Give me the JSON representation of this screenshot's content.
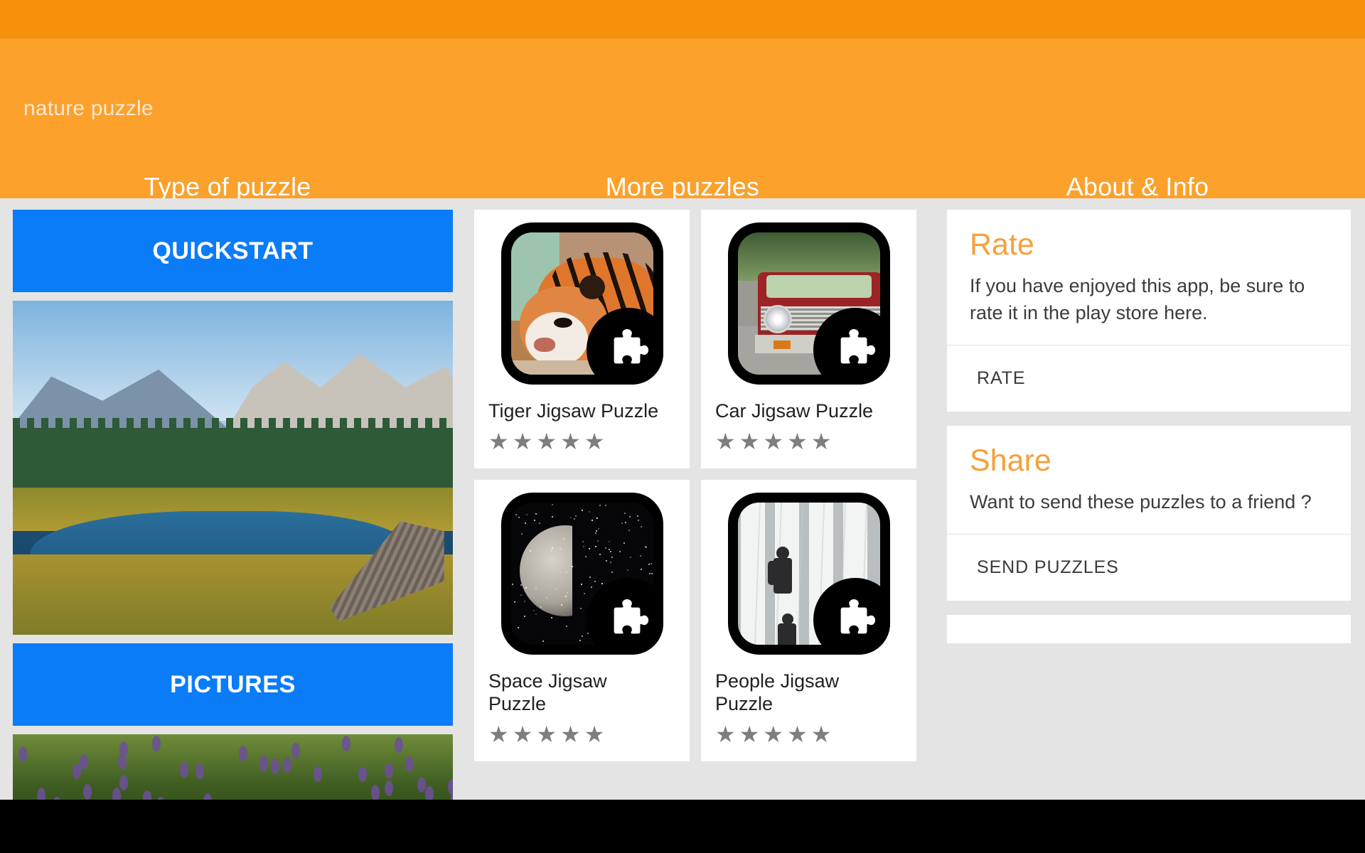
{
  "app": {
    "title": "nature puzzle",
    "accent_orange": "#FBA12C",
    "status_orange": "#F7900A",
    "accent_blue": "#0A7CF7",
    "page_background": "#E4E4E4"
  },
  "tabs": [
    {
      "label": "Type of puzzle"
    },
    {
      "label": "More puzzles"
    },
    {
      "label": "About & Info"
    }
  ],
  "left_panel": {
    "quickstart_label": "QUICKSTART",
    "pictures_label": "PICTURES",
    "preview_alt": "mountain lake nature scene",
    "preview2_alt": "purple flower meadow"
  },
  "puzzle_cards": [
    {
      "title": "Tiger Jigsaw Puzzle",
      "stars": 5,
      "image": "tiger"
    },
    {
      "title": "Car Jigsaw Puzzle",
      "stars": 5,
      "image": "car"
    },
    {
      "title": "Space Jigsaw Puzzle",
      "stars": 5,
      "image": "space"
    },
    {
      "title": "People Jigsaw Puzzle",
      "stars": 5,
      "image": "people"
    }
  ],
  "star_glyph": "★",
  "info_cards": [
    {
      "heading": "Rate",
      "text": "If you have enjoyed this app, be sure to rate it in the play store here.",
      "action": "RATE"
    },
    {
      "heading": "Share",
      "text": "Want to send these puzzles to a friend ?",
      "action": "SEND PUZZLES"
    }
  ]
}
